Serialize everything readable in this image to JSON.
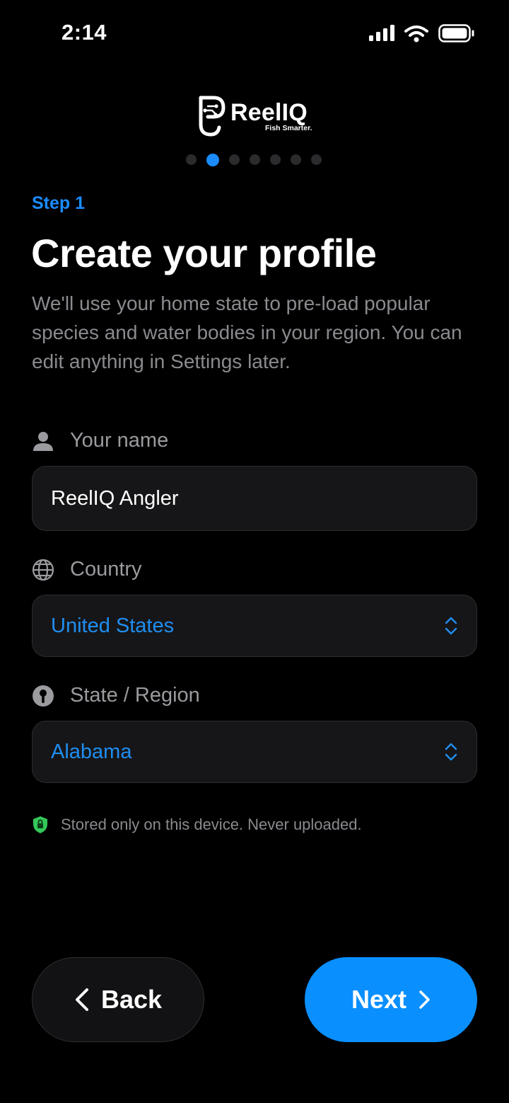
{
  "status_bar": {
    "time": "2:14",
    "icons": [
      "cellular-signal-icon",
      "wifi-icon",
      "battery-icon"
    ]
  },
  "brand": {
    "name": "ReelIQ",
    "tagline": "Fish Smarter."
  },
  "progress": {
    "total_steps": 7,
    "current_index": 1
  },
  "step_label": "Step 1",
  "title": "Create your profile",
  "subtitle": "We'll use your home state to pre-load popular species and water bodies in your region. You can edit anything in Settings later.",
  "fields": {
    "name": {
      "label": "Your name",
      "value": "ReelIQ Angler",
      "icon": "person-icon"
    },
    "country": {
      "label": "Country",
      "value": "United States",
      "icon": "globe-icon"
    },
    "state": {
      "label": "State / Region",
      "value": "Alabama",
      "icon": "location-pin-icon"
    }
  },
  "privacy_note": "Stored only on this device. Never uploaded.",
  "buttons": {
    "back": "Back",
    "next": "Next"
  },
  "colors": {
    "accent": "#0a8fff",
    "step_label": "#1a8cff",
    "select_value": "#1f8ef0",
    "privacy_shield": "#34c759",
    "background": "#000000"
  }
}
